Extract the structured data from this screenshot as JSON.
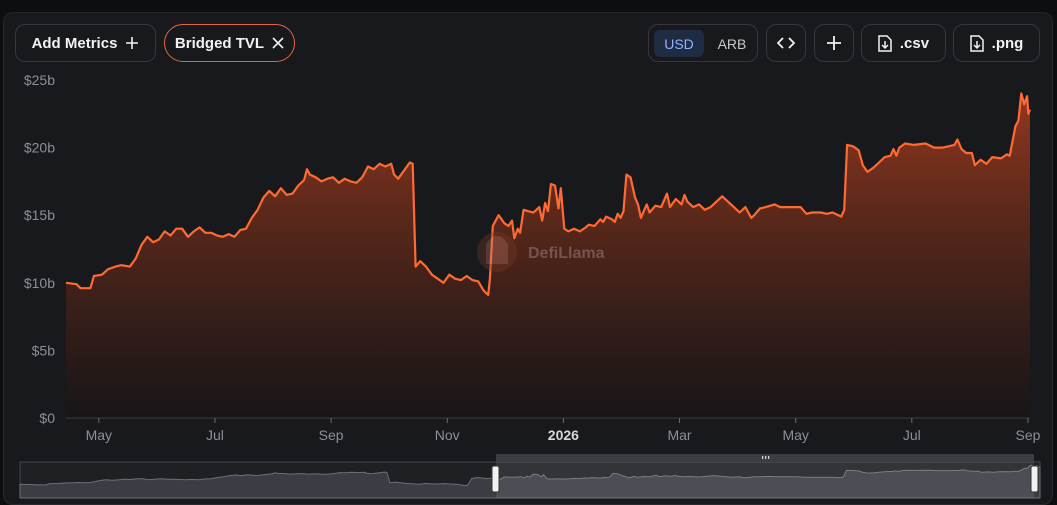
{
  "toolbar": {
    "add_metrics_label": "Add Metrics",
    "metric_chip_label": "Bridged TVL",
    "currency_options": [
      "USD",
      "ARB"
    ],
    "selected_currency": "USD",
    "csv_label": ".csv",
    "png_label": ".png"
  },
  "watermark": "DefiLlama",
  "colors": {
    "line": "#ff6a33",
    "area_top": "#9a3a1e",
    "area_bottom": "#1a1414",
    "accent": "#e2653c"
  },
  "chart_data": {
    "type": "area",
    "y_ticks": [
      "$0",
      "$5b",
      "$10b",
      "$15b",
      "$20b",
      "$25b"
    ],
    "ylim": [
      0,
      25
    ],
    "x_ticks": [
      {
        "label": "May",
        "t": 0.565
      },
      {
        "label": "Jul",
        "t": 2.565
      },
      {
        "label": "Sep",
        "t": 4.565
      },
      {
        "label": "Nov",
        "t": 6.565
      },
      {
        "label": "2026",
        "t": 8.565
      },
      {
        "label": "Mar",
        "t": 10.565
      },
      {
        "label": "May",
        "t": 12.565
      },
      {
        "label": "Jul",
        "t": 14.565
      },
      {
        "label": "Sep",
        "t": 16.565
      }
    ],
    "xlim": [
      0,
      16.6
    ],
    "grid": false,
    "series": [
      {
        "values": [
          [
            0.0,
            10.0
          ],
          [
            0.18,
            9.9
          ],
          [
            0.25,
            9.6
          ],
          [
            0.42,
            9.6
          ],
          [
            0.48,
            10.5
          ],
          [
            0.62,
            10.6
          ],
          [
            0.72,
            11.0
          ],
          [
            0.85,
            11.2
          ],
          [
            0.95,
            11.3
          ],
          [
            1.1,
            11.2
          ],
          [
            1.2,
            11.8
          ],
          [
            1.3,
            12.8
          ],
          [
            1.4,
            13.4
          ],
          [
            1.5,
            13.0
          ],
          [
            1.6,
            13.2
          ],
          [
            1.7,
            13.8
          ],
          [
            1.8,
            13.5
          ],
          [
            1.9,
            14.0
          ],
          [
            2.0,
            14.0
          ],
          [
            2.1,
            13.4
          ],
          [
            2.2,
            13.8
          ],
          [
            2.3,
            14.1
          ],
          [
            2.4,
            13.7
          ],
          [
            2.5,
            13.7
          ],
          [
            2.6,
            13.5
          ],
          [
            2.7,
            13.4
          ],
          [
            2.8,
            13.6
          ],
          [
            2.9,
            13.4
          ],
          [
            3.0,
            13.9
          ],
          [
            3.1,
            14.0
          ],
          [
            3.2,
            14.8
          ],
          [
            3.3,
            15.4
          ],
          [
            3.4,
            16.3
          ],
          [
            3.5,
            16.8
          ],
          [
            3.6,
            16.4
          ],
          [
            3.7,
            17.0
          ],
          [
            3.8,
            16.5
          ],
          [
            3.9,
            16.6
          ],
          [
            4.0,
            17.2
          ],
          [
            4.1,
            17.6
          ],
          [
            4.15,
            18.4
          ],
          [
            4.2,
            18.0
          ],
          [
            4.3,
            17.8
          ],
          [
            4.4,
            17.5
          ],
          [
            4.5,
            17.7
          ],
          [
            4.6,
            17.8
          ],
          [
            4.7,
            17.4
          ],
          [
            4.8,
            17.7
          ],
          [
            4.9,
            17.5
          ],
          [
            5.0,
            17.4
          ],
          [
            5.1,
            17.8
          ],
          [
            5.2,
            18.6
          ],
          [
            5.3,
            18.4
          ],
          [
            5.4,
            18.8
          ],
          [
            5.5,
            18.6
          ],
          [
            5.6,
            18.8
          ],
          [
            5.65,
            18.0
          ],
          [
            5.72,
            17.7
          ],
          [
            5.82,
            18.3
          ],
          [
            5.92,
            18.9
          ],
          [
            5.97,
            18.8
          ],
          [
            6.02,
            11.2
          ],
          [
            6.1,
            11.6
          ],
          [
            6.2,
            11.2
          ],
          [
            6.3,
            10.6
          ],
          [
            6.4,
            10.3
          ],
          [
            6.5,
            10.0
          ],
          [
            6.6,
            10.6
          ],
          [
            6.7,
            10.3
          ],
          [
            6.8,
            10.2
          ],
          [
            6.9,
            10.5
          ],
          [
            7.0,
            10.2
          ],
          [
            7.1,
            10.1
          ],
          [
            7.18,
            9.5
          ],
          [
            7.22,
            9.3
          ],
          [
            7.27,
            9.1
          ],
          [
            7.3,
            10.3
          ],
          [
            7.35,
            14.2
          ],
          [
            7.45,
            15.0
          ],
          [
            7.55,
            14.4
          ],
          [
            7.62,
            14.2
          ],
          [
            7.68,
            14.6
          ],
          [
            7.72,
            13.3
          ],
          [
            7.78,
            14.0
          ],
          [
            7.82,
            13.7
          ],
          [
            7.88,
            15.4
          ],
          [
            7.95,
            15.3
          ],
          [
            8.05,
            15.2
          ],
          [
            8.15,
            15.6
          ],
          [
            8.2,
            14.6
          ],
          [
            8.25,
            15.9
          ],
          [
            8.3,
            15.3
          ],
          [
            8.35,
            17.3
          ],
          [
            8.42,
            17.2
          ],
          [
            8.48,
            15.5
          ],
          [
            8.52,
            17.0
          ],
          [
            8.58,
            14.0
          ],
          [
            8.65,
            13.8
          ],
          [
            8.75,
            14.0
          ],
          [
            8.85,
            13.8
          ],
          [
            8.95,
            14.1
          ],
          [
            9.0,
            14.3
          ],
          [
            9.1,
            14.2
          ],
          [
            9.2,
            14.7
          ],
          [
            9.25,
            14.5
          ],
          [
            9.3,
            14.9
          ],
          [
            9.4,
            14.7
          ],
          [
            9.45,
            14.5
          ],
          [
            9.5,
            15.1
          ],
          [
            9.55,
            14.8
          ],
          [
            9.6,
            15.3
          ],
          [
            9.65,
            18.0
          ],
          [
            9.72,
            17.8
          ],
          [
            9.8,
            16.3
          ],
          [
            9.85,
            15.8
          ],
          [
            9.9,
            14.8
          ],
          [
            9.95,
            15.3
          ],
          [
            10.0,
            15.8
          ],
          [
            10.05,
            15.2
          ],
          [
            10.15,
            15.7
          ],
          [
            10.25,
            15.6
          ],
          [
            10.35,
            16.6
          ],
          [
            10.4,
            15.6
          ],
          [
            10.5,
            16.2
          ],
          [
            10.6,
            15.8
          ],
          [
            10.65,
            16.5
          ],
          [
            10.7,
            16.0
          ],
          [
            10.8,
            15.6
          ],
          [
            10.9,
            15.8
          ],
          [
            11.0,
            15.4
          ],
          [
            11.1,
            15.6
          ],
          [
            11.2,
            16.0
          ],
          [
            11.3,
            16.4
          ],
          [
            11.4,
            16.0
          ],
          [
            11.5,
            15.6
          ],
          [
            11.6,
            15.2
          ],
          [
            11.7,
            15.6
          ],
          [
            11.8,
            14.8
          ],
          [
            11.85,
            15.0
          ],
          [
            11.95,
            15.5
          ],
          [
            12.05,
            15.6
          ],
          [
            12.2,
            15.8
          ],
          [
            12.3,
            15.6
          ],
          [
            12.4,
            15.6
          ],
          [
            12.55,
            15.6
          ],
          [
            12.65,
            15.6
          ],
          [
            12.75,
            15.1
          ],
          [
            12.85,
            15.2
          ],
          [
            13.0,
            15.2
          ],
          [
            13.1,
            15.1
          ],
          [
            13.2,
            15.2
          ],
          [
            13.3,
            15.0
          ],
          [
            13.35,
            14.9
          ],
          [
            13.4,
            15.4
          ],
          [
            13.45,
            20.2
          ],
          [
            13.55,
            20.1
          ],
          [
            13.65,
            19.8
          ],
          [
            13.72,
            18.7
          ],
          [
            13.8,
            18.2
          ],
          [
            13.9,
            18.5
          ],
          [
            14.0,
            18.9
          ],
          [
            14.1,
            19.3
          ],
          [
            14.2,
            19.4
          ],
          [
            14.25,
            19.9
          ],
          [
            14.3,
            19.4
          ],
          [
            14.35,
            20.0
          ],
          [
            14.45,
            20.3
          ],
          [
            14.6,
            20.2
          ],
          [
            14.8,
            20.3
          ],
          [
            14.95,
            20.0
          ],
          [
            15.1,
            20.0
          ],
          [
            15.3,
            20.2
          ],
          [
            15.35,
            20.6
          ],
          [
            15.42,
            19.9
          ],
          [
            15.5,
            19.6
          ],
          [
            15.6,
            19.6
          ],
          [
            15.65,
            18.7
          ],
          [
            15.75,
            19.1
          ],
          [
            15.85,
            18.8
          ],
          [
            15.95,
            19.3
          ],
          [
            16.1,
            19.2
          ],
          [
            16.2,
            19.5
          ],
          [
            16.25,
            19.4
          ],
          [
            16.35,
            21.6
          ],
          [
            16.4,
            22.0
          ],
          [
            16.45,
            24.0
          ],
          [
            16.5,
            23.2
          ],
          [
            16.55,
            23.8
          ],
          [
            16.57,
            22.5
          ],
          [
            16.6,
            22.8
          ]
        ]
      }
    ]
  }
}
